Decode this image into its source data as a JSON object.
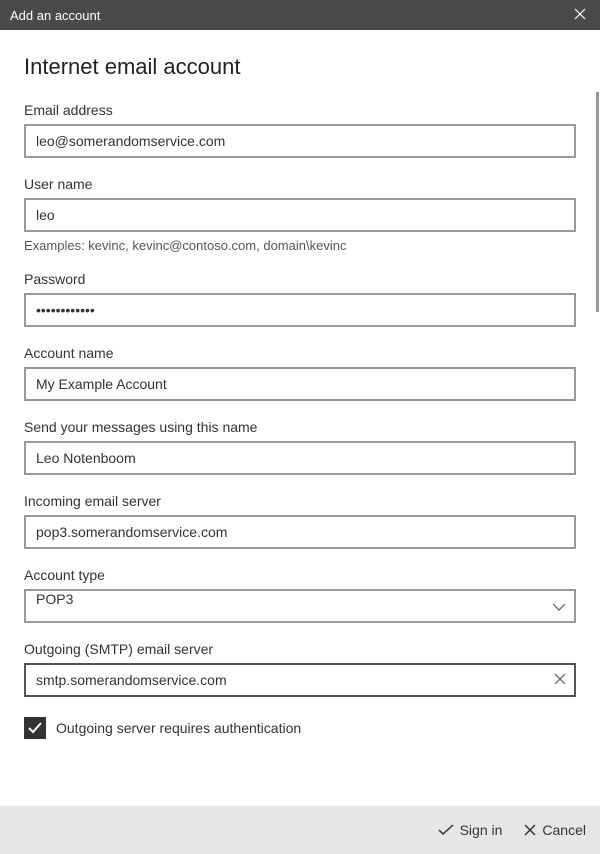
{
  "window": {
    "title": "Add an account"
  },
  "heading": "Internet email account",
  "fields": {
    "email": {
      "label": "Email address",
      "value": "leo@somerandomservice.com"
    },
    "username": {
      "label": "User name",
      "value": "leo",
      "helper": "Examples: kevinc, kevinc@contoso.com, domain\\kevinc"
    },
    "password": {
      "label": "Password",
      "value": "••••••••••••"
    },
    "accountName": {
      "label": "Account name",
      "value": "My Example Account"
    },
    "sendName": {
      "label": "Send your messages using this name",
      "value": "Leo Notenboom"
    },
    "incoming": {
      "label": "Incoming email server",
      "value": "pop3.somerandomservice.com"
    },
    "accountType": {
      "label": "Account type",
      "value": "POP3"
    },
    "outgoing": {
      "label": "Outgoing (SMTP) email server",
      "value": "smtp.somerandomservice.com"
    }
  },
  "checkbox": {
    "outgoingAuth": {
      "label": "Outgoing server requires authentication",
      "checked": true
    }
  },
  "footer": {
    "signIn": "Sign in",
    "cancel": "Cancel"
  }
}
